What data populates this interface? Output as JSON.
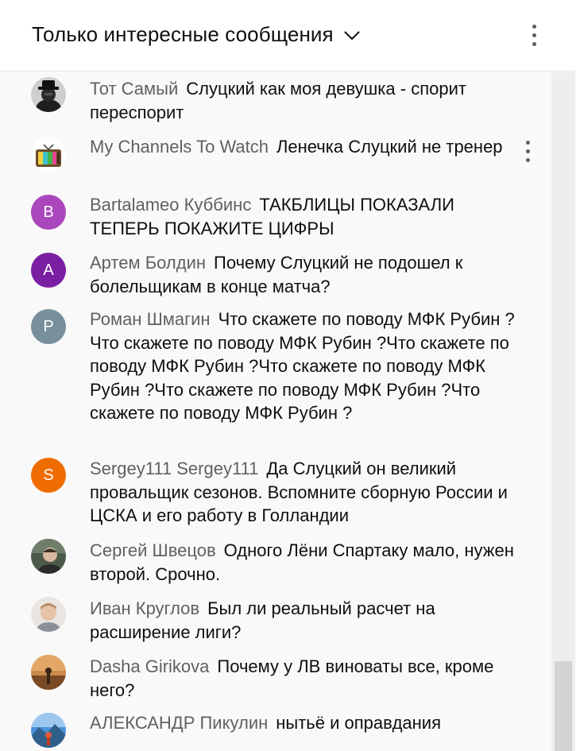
{
  "header": {
    "title": "Только интересные сообщения",
    "menu_icon": "more-vert-icon",
    "chevron_icon": "chevron-down-icon"
  },
  "messages": [
    {
      "author": "Тот Самый",
      "text": "Слуцкий как моя девушка - спорит переспорит",
      "avatar_type": "photo"
    },
    {
      "author": "My Channels To Watch",
      "text": "Ленечка Слуцкий не тренер",
      "avatar_type": "photo"
    },
    {
      "author": "Bartalameo Куббинс",
      "text": "ТАКБЛИЦЫ ПОКАЗАЛИ ТЕПЕРЬ ПОКАЖИТЕ ЦИФРЫ",
      "avatar_letter": "B",
      "avatar_color": "#ab47bc"
    },
    {
      "author": "Артем Болдин",
      "text": "Почему Слуцкий не подошел к болельщикам в конце матча?",
      "avatar_letter": "A",
      "avatar_color": "#7b1fa2"
    },
    {
      "author": "Роман Шмагин",
      "text": "Что скажете по поводу МФК Рубин ?Что скажете по поводу МФК Рубин ?Что скажете по поводу МФК Рубин ?Что скажете по поводу МФК Рубин ?Что скажете по поводу МФК Рубин ?Что скажете по поводу МФК Рубин ?",
      "avatar_letter": "P",
      "avatar_color": "#78909c"
    },
    {
      "author": "Sergey111 Sergey111",
      "text": "Да Слуцкий он великий провальщик сезонов. Вспомните сборную России и ЦСКА и его работу в Голландии",
      "avatar_letter": "S",
      "avatar_color": "#ef6c00"
    },
    {
      "author": "Сергей Швецов",
      "text": "Одного Лёни Спартаку мало, нужен второй. Срочно.",
      "avatar_type": "photo"
    },
    {
      "author": "Иван Круглов",
      "text": "Был ли реальный расчет на расширение лиги?",
      "avatar_type": "photo"
    },
    {
      "author": "Dasha Girikova",
      "text": "Почему у ЛВ виноваты все, кроме него?",
      "avatar_type": "photo"
    },
    {
      "author": "АЛЕКСАНДР Пикулин",
      "text": "нытьё и оправдания",
      "avatar_type": "photo"
    }
  ],
  "colors": {
    "header_bg": "#ffffff",
    "chat_bg": "#f9f9f9",
    "author": "#606060",
    "text": "#0f0f0f"
  }
}
